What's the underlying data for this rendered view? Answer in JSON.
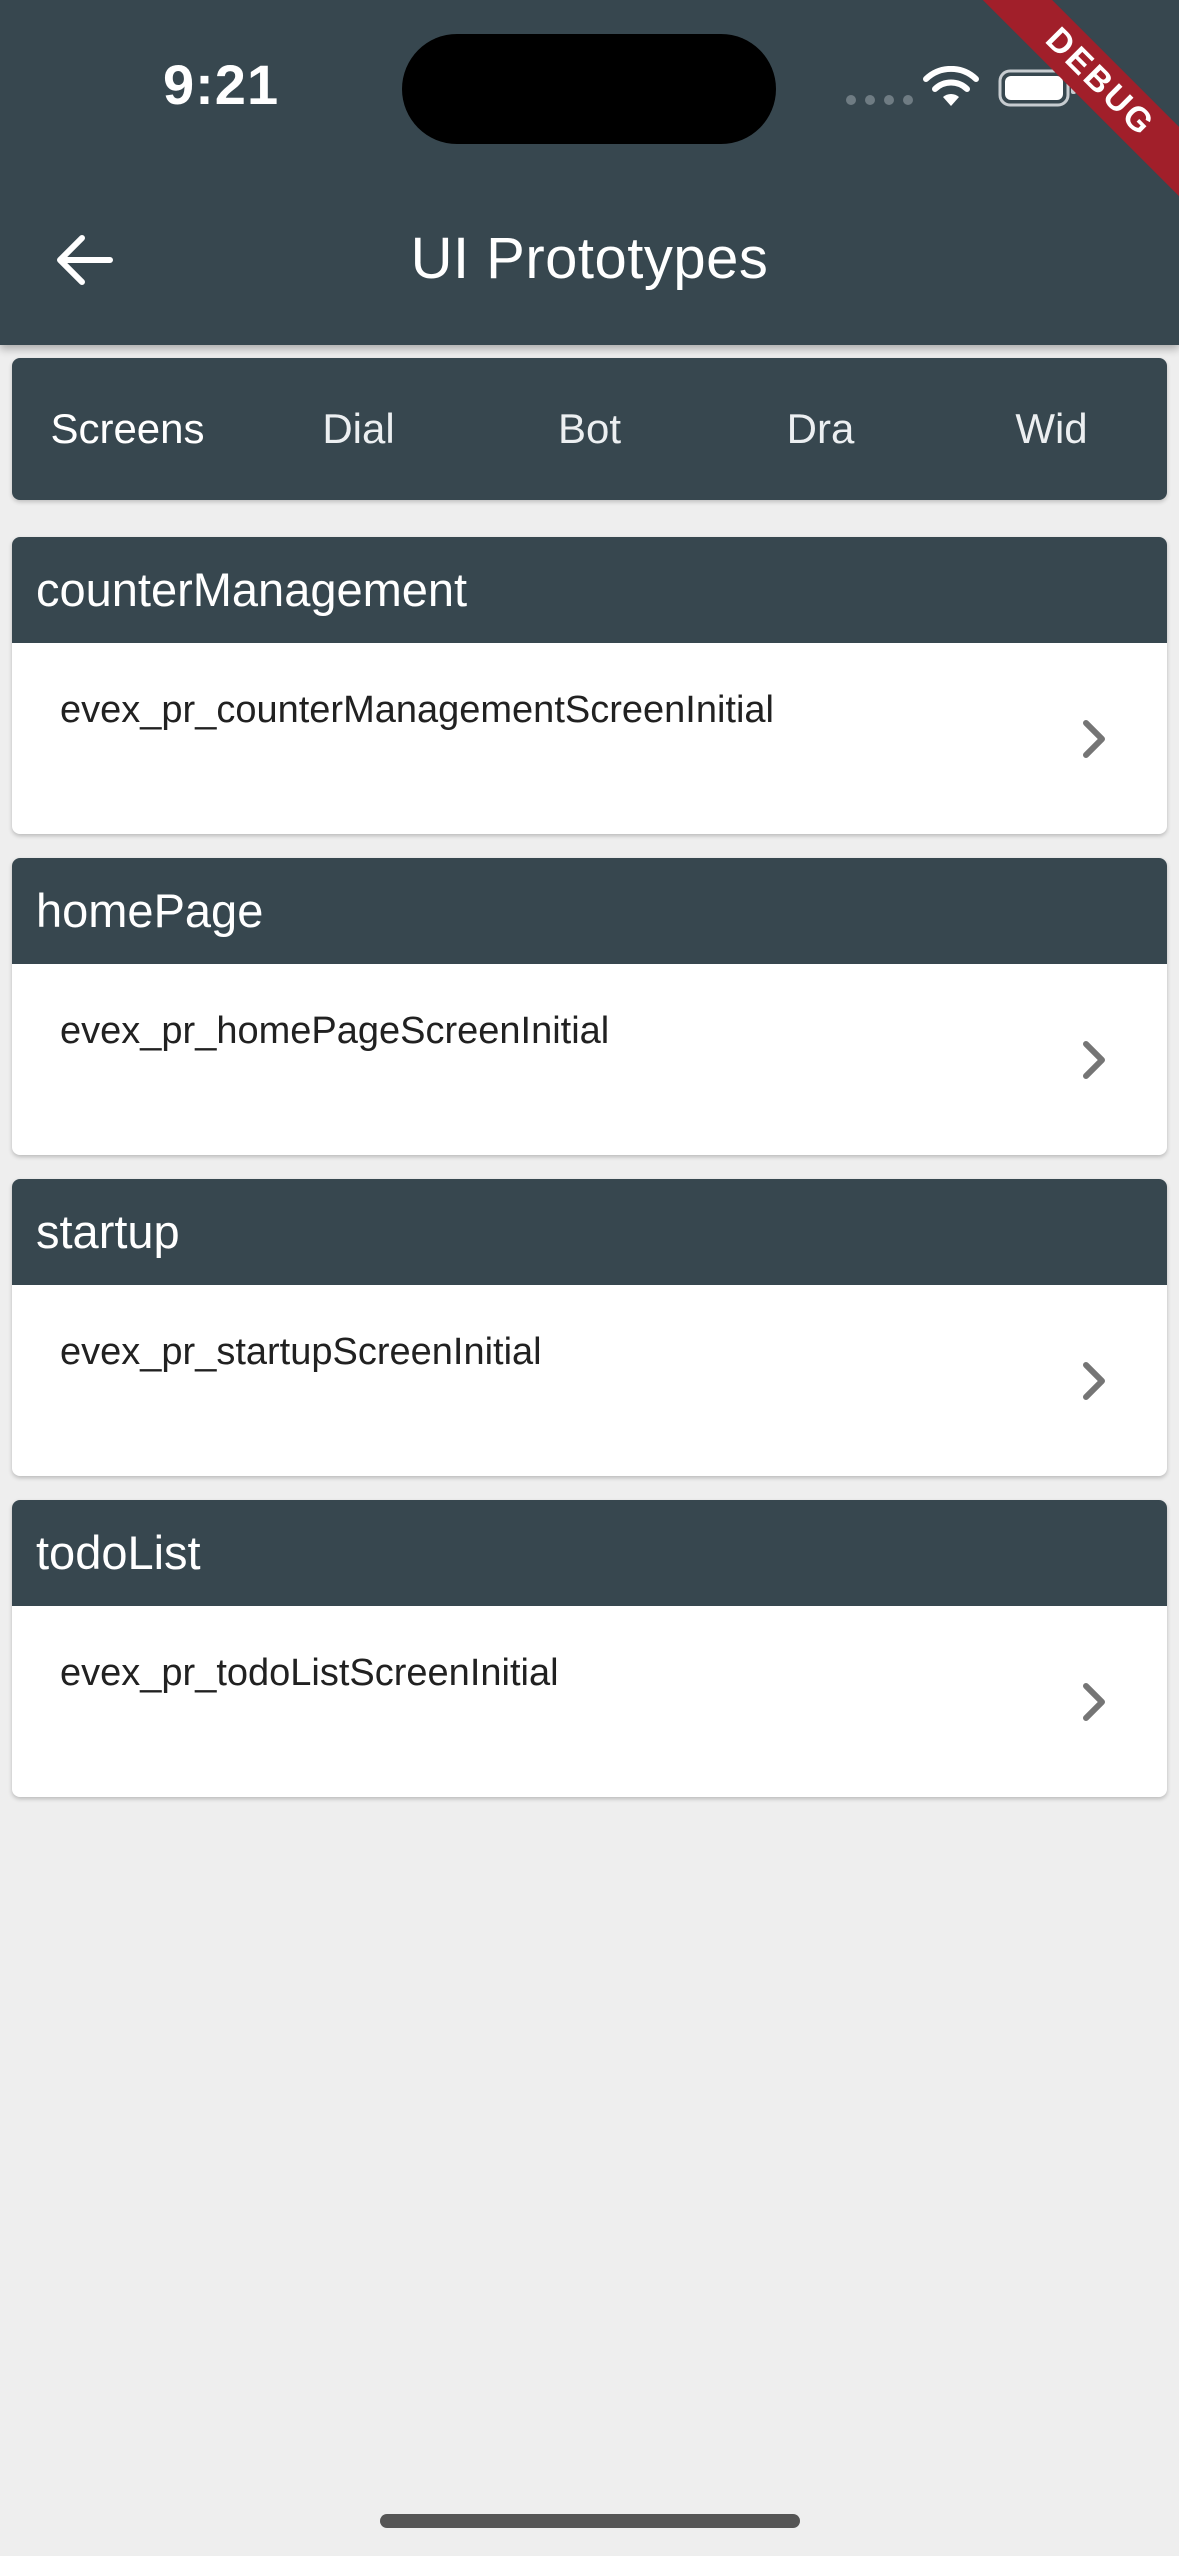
{
  "status_bar": {
    "time": "9:21"
  },
  "app_bar": {
    "title": "UI Prototypes"
  },
  "debug_banner": "DEBUG",
  "tabs": [
    {
      "label": "Screens",
      "active": true
    },
    {
      "label": "Dial",
      "active": false
    },
    {
      "label": "Bot",
      "active": false
    },
    {
      "label": "Dra",
      "active": false
    },
    {
      "label": "Wid",
      "active": false
    }
  ],
  "sections": [
    {
      "title": "counterManagement",
      "item": "evex_pr_counterManagementScreenInitial"
    },
    {
      "title": "homePage",
      "item": "evex_pr_homePageScreenInitial"
    },
    {
      "title": "startup",
      "item": "evex_pr_startupScreenInitial"
    },
    {
      "title": "todoList",
      "item": "evex_pr_todoListScreenInitial"
    }
  ],
  "icons": {
    "back": "arrow-left-icon",
    "row_action": "chevron-right-icon",
    "wifi": "wifi-icon",
    "battery": "battery-icon"
  },
  "colors": {
    "primary": "#37474f",
    "background": "#eeeeee",
    "debug": "#a11f2a"
  }
}
